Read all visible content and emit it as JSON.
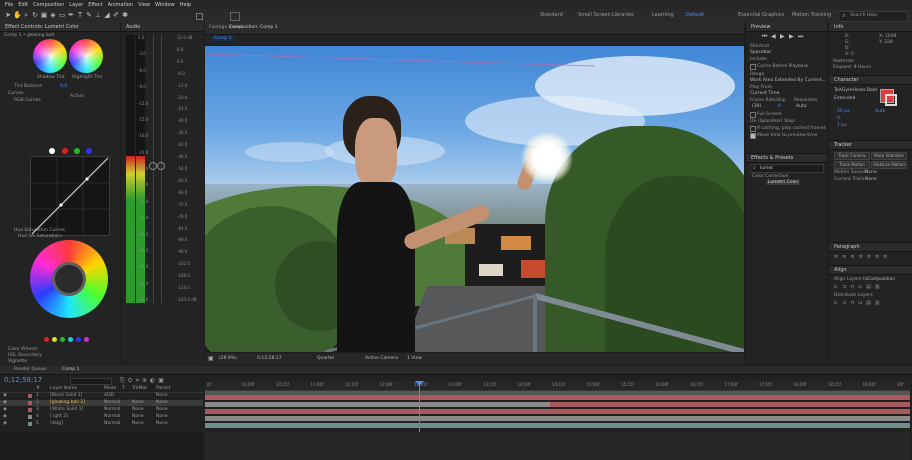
{
  "menu": [
    "File",
    "Edit",
    "Composition",
    "Layer",
    "Effect",
    "Animation",
    "View",
    "Window",
    "Help"
  ],
  "workspaces": [
    {
      "label": "Standard",
      "active": false
    },
    {
      "label": "Small Screen",
      "active": false
    },
    {
      "label": "Libraries",
      "active": false
    },
    {
      "label": "Learning",
      "active": false
    },
    {
      "label": "Default",
      "active": false
    },
    {
      "label": "Essential Graphics",
      "active": true
    },
    {
      "label": "Motion Tracking",
      "active": false
    }
  ],
  "search": {
    "placeholder": "Search Help"
  },
  "effect_controls": {
    "tab": "Effect Controls: Lumetri Color",
    "comp_label": "Comp 1 • glowing ball",
    "shadow_tint": "Shadow Tint",
    "highlight_tint": "Highlight Tint",
    "tint_balance": "Tint Balance",
    "tint_balance_value": "0.0",
    "curves": "Curves",
    "rgb_curves": "RGB Curves",
    "hue_sat": "Hue Saturation Curves",
    "hue_vs_sat": "Hue (vs Saturation)",
    "color_wheels": "Color Wheels",
    "hsl_secondary": "HSL Secondary",
    "vignette": "Vignette",
    "active": "Active"
  },
  "audio": {
    "tab": "Audio",
    "left_scale": [
      "0.0",
      "-3.0",
      "-6.0",
      "-9.0",
      "-12.0",
      "-15.0",
      "-18.0",
      "-21.0",
      "-24.0",
      "-27.0",
      "-30.0",
      "-33.0",
      "-36.0",
      "-39.0",
      "-42.0",
      "-45.0",
      "-48.0"
    ],
    "right_scale": [
      "12.0 dB",
      "6.0",
      "0.0",
      "-6.0",
      "-12.0",
      "-18.0",
      "-24.0",
      "-30.0",
      "-36.0",
      "-42.0",
      "-48.0",
      "-54.0",
      "-60.0",
      "-66.0",
      "-72.0",
      "-78.0",
      "-84.0",
      "-90.0",
      "-96.0",
      "-102.0",
      "-108.0",
      "-114.0",
      "-120.0 dB"
    ],
    "level_fraction": 0.55
  },
  "viewer": {
    "tabs": [
      "Footage (none)",
      "Composition: Comp 1"
    ],
    "comp_tab": "Comp 1",
    "zoom": "(29.9%)",
    "timecode": "0;12;58;17",
    "resolution": "Quarter",
    "camera": "Active Camera",
    "views": "1 View"
  },
  "preview": {
    "title": "Preview",
    "shortcut_label": "Shortcut",
    "shortcut_value": "Spacebar",
    "include_label": "Include:",
    "cache": "Cache Before Playback",
    "range": "Range",
    "range_value": "Work Area Extended By Current...",
    "play_from": "Play From",
    "play_from_value": "Current Time",
    "frame_rate": "Frame Rate",
    "skip": "Skip",
    "resolution": "Resolution",
    "fps_value": "(30)",
    "skip_value": "0",
    "res_value": "Auto",
    "full_screen": "Full Screen",
    "on_stop": "On (Spacebar) Stop:",
    "if_caching": "If caching, play cached frames",
    "move_time": "Move time to preview time"
  },
  "effects_presets": {
    "title": "Effects & Presets",
    "search": "lumet",
    "category": "Color Correction",
    "item": "Lumetri Color"
  },
  "info": {
    "title": "Info",
    "lines": [
      "R:",
      "G:",
      "B:",
      "A: 0",
      "X: 1048",
      "Y: 328"
    ],
    "footer_lines": [
      "Rasterize",
      "Elapsed: 9 Hours"
    ]
  },
  "character": {
    "title": "Character",
    "font": "TeXGyreHeros Bold",
    "style": "Extended",
    "size": "50 px",
    "leading": "Auto",
    "tracking": "0",
    "stroke": "1 px",
    "fill_color": "#e03a3a"
  },
  "tracker": {
    "title": "Tracker",
    "buttons": [
      "Track Camera",
      "Warp Stabilizer",
      "Track Motion",
      "Stabilize Motion"
    ],
    "motion_source_label": "Motion Source:",
    "motion_source": "None",
    "current_track_label": "Current Track:",
    "current_track": "None"
  },
  "paragraph": {
    "title": "Paragraph"
  },
  "align": {
    "title": "Align",
    "align_to_label": "Align Layers to:",
    "align_to": "Composition",
    "distribute_label": "Distribute Layers:"
  },
  "timeline": {
    "tabs": [
      "Render Queue",
      "Comp 1"
    ],
    "timecode": "0;12;58;17",
    "columns": [
      "#",
      "Layer Name",
      "Mode",
      "T",
      "TrkMat",
      "Parent"
    ],
    "ruler": [
      "0f",
      "10;00f",
      "10;15f",
      "11;00f",
      "11;15f",
      "12;00f",
      "12;15f",
      "13;00f",
      "13;15f",
      "14;00f",
      "14;15f",
      "15;00f",
      "15;15f",
      "16;00f",
      "16;15f",
      "17;00f",
      "17;15f",
      "18;00f",
      "18;15f",
      "19;00f",
      "20f"
    ],
    "layers": [
      {
        "num": "1",
        "name": "[Black Solid 1]",
        "mode": "ADD",
        "trk": "",
        "parent": "None"
      },
      {
        "num": "2",
        "name": "[glowing ball 2]",
        "mode": "Normal",
        "trk": "None",
        "parent": "None"
      },
      {
        "num": "3",
        "name": "[White Solid 1]",
        "mode": "Normal",
        "trk": "None",
        "parent": "None"
      },
      {
        "num": "4",
        "name": "[ ight 2]",
        "mode": "Normal",
        "trk": "None",
        "parent": "None"
      },
      {
        "num": "5",
        "name": "[dsig]",
        "mode": "Normal",
        "trk": "None",
        "parent": "None"
      }
    ]
  },
  "colors": {
    "accent": "#4d8ef0",
    "timeline_bar": "#a85a5e",
    "timeline_bar2": "#6e8e8c",
    "bar_grey": "#8a8a8a"
  }
}
